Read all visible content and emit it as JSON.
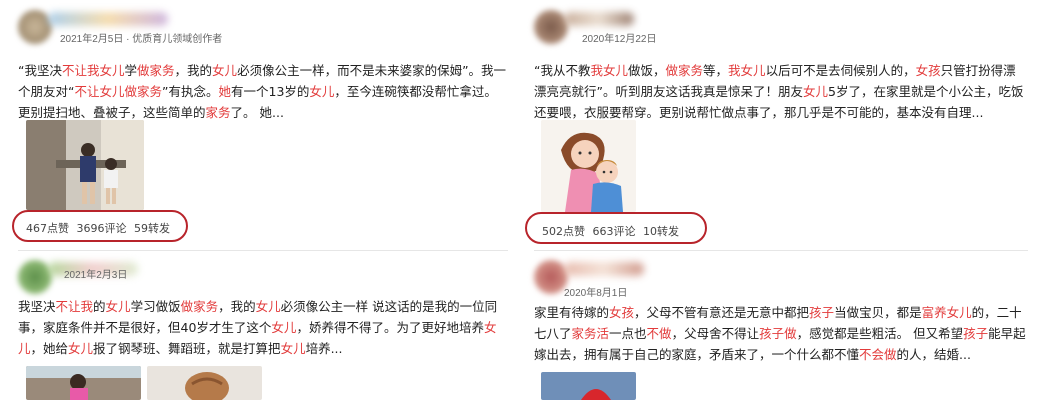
{
  "posts": [
    {
      "meta": "2021年2月5日 · 优质育儿领域创作者",
      "segments": [
        {
          "t": "“我坚决"
        },
        {
          "t": "不让我女儿",
          "h": true
        },
        {
          "t": "学"
        },
        {
          "t": "做家务",
          "h": true
        },
        {
          "t": "，我的"
        },
        {
          "t": "女儿",
          "h": true
        },
        {
          "t": "必须像公主一样，而不是未来婆家的保姆”。我一个朋友对“"
        },
        {
          "t": "不让女儿做家务",
          "h": true
        },
        {
          "t": "”有执念。"
        },
        {
          "t": "她",
          "h": true
        },
        {
          "t": "有一个13岁的"
        },
        {
          "t": "女儿",
          "h": true
        },
        {
          "t": "，至今连碗筷都没帮忙拿过。更别提扫地、叠被子，这些简单的"
        },
        {
          "t": "家务",
          "h": true
        },
        {
          "t": "了。 她..."
        }
      ],
      "stats": {
        "likes": "467点赞",
        "comments": "3696评论",
        "shares": "59转发"
      },
      "image": "kids-in-kitchen-photo"
    },
    {
      "meta": "2020年12月22日",
      "segments": [
        {
          "t": "“我从不教"
        },
        {
          "t": "我女儿",
          "h": true
        },
        {
          "t": "做饭，"
        },
        {
          "t": "做家务",
          "h": true
        },
        {
          "t": "等，"
        },
        {
          "t": "我女儿",
          "h": true
        },
        {
          "t": "以后可不是去伺候别人的，"
        },
        {
          "t": "女孩",
          "h": true
        },
        {
          "t": "只管打扮得漂漂亮亮就行”。听到朋友这话我真是惊呆了！朋友"
        },
        {
          "t": "女儿",
          "h": true
        },
        {
          "t": "5岁了，在家里就是个小公主，吃饭还要喂，衣服要帮穿。更别说帮忙做点事了，那几乎是不可能的，基本没有自理..."
        }
      ],
      "stats": {
        "likes": "502点赞",
        "comments": "663评论",
        "shares": "10转发"
      },
      "image": "mother-and-child-cartoon"
    },
    {
      "meta": "2021年2月3日",
      "segments": [
        {
          "t": "我坚决"
        },
        {
          "t": "不让我",
          "h": true
        },
        {
          "t": "的"
        },
        {
          "t": "女儿",
          "h": true
        },
        {
          "t": "学习做饭"
        },
        {
          "t": "做家务",
          "h": true
        },
        {
          "t": "，我的"
        },
        {
          "t": "女儿",
          "h": true
        },
        {
          "t": "必须像公主一样 说这话的是我的一位同事，家庭条件并不是很好，但40岁才生了这个"
        },
        {
          "t": "女儿",
          "h": true
        },
        {
          "t": "，娇养得不得了。为了更好地培养"
        },
        {
          "t": "女儿",
          "h": true
        },
        {
          "t": "，她给"
        },
        {
          "t": "女儿",
          "h": true
        },
        {
          "t": "报了钢琴班、舞蹈班，就是打算把"
        },
        {
          "t": "女儿",
          "h": true
        },
        {
          "t": "培养..."
        }
      ],
      "images": [
        "girl-outdoor-photo",
        "girl-braided-hair-photo"
      ]
    },
    {
      "meta": "2020年8月1日",
      "segments": [
        {
          "t": "家里有待嫁的"
        },
        {
          "t": "女孩",
          "h": true
        },
        {
          "t": "，父母不管有意还是无意中都把"
        },
        {
          "t": "孩子",
          "h": true
        },
        {
          "t": "当做宝贝，都是"
        },
        {
          "t": "富养女儿",
          "h": true
        },
        {
          "t": "的，二十七八了"
        },
        {
          "t": "家务活",
          "h": true
        },
        {
          "t": "一点也"
        },
        {
          "t": "不做",
          "h": true
        },
        {
          "t": "，父母舍不得让"
        },
        {
          "t": "孩子做",
          "h": true
        },
        {
          "t": "，感觉都是些粗活。 但又希望"
        },
        {
          "t": "孩子",
          "h": true
        },
        {
          "t": "能早起嫁出去，拥有属于自己的家庭，矛盾来了，一个什么都不懂"
        },
        {
          "t": "不会做",
          "h": true
        },
        {
          "t": "的人，结婚..."
        }
      ],
      "image": "red-umbrella-photo"
    }
  ],
  "colors": {
    "highlight": "#e23b3b",
    "annotation": "#b8242b"
  }
}
